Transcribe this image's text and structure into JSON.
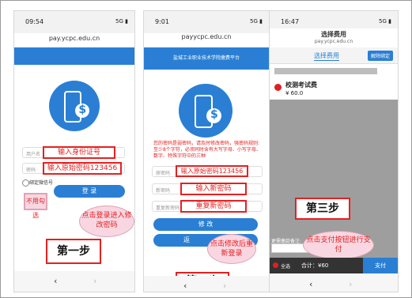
{
  "phone1": {
    "time": "09:54",
    "status_icons": "5G ▮",
    "url": "pay.ycpc.edu.cn",
    "user_placeholder": "用户名",
    "user_hint": "输入身份证号",
    "pass_placeholder": "密码",
    "pass_hint": "输入原始密码123456",
    "bind_wechat": "绑定微信号",
    "no_check_note": "不用勾选",
    "login_btn": "登 录",
    "login_tip": "点击登录进入修改密码",
    "step_label": "第一步",
    "nav_back": "‹",
    "nav_fwd": "›"
  },
  "phone2": {
    "time": "9:01",
    "status_icons": "5G ▮",
    "url": "payycpc.edu.cn",
    "banner": "盐城工业职业技术学院缴费平台",
    "notice": "您的密码是弱密码，请及时修改密码，强密码规则:至少8个字符，必须同时含有大写字母、小写字母、数字、特殊字符中的三种",
    "orig_label": "原密码",
    "orig_hint": "输入原始密码123456",
    "new_label": "新密码",
    "new_hint": "输入新密码",
    "repeat_label": "重复新密码",
    "repeat_hint": "重复新密码",
    "modify_btn": "修 改",
    "back_btn": "返",
    "modify_tip": "点击修改后重新登录",
    "step_label": "第二步",
    "nav_back": "‹",
    "nav_fwd": "›"
  },
  "phone3": {
    "time": "16:47",
    "status_icons": "5G ▮",
    "page_title": "选择费用",
    "url": "pay.ycpc.edu.cn",
    "tab_label": "选择费用",
    "unbind_btn": "解除绑定",
    "fee_name": "校测考试费",
    "fee_amount": "¥ 60.0",
    "step_label": "第三步",
    "remark_label": "更需缴款备注:",
    "pay_tip": "点击支付按钮进行支付",
    "select_all": "全选",
    "total": "合计：¥60",
    "pay_btn": "支付",
    "nav_back": "‹",
    "nav_fwd": "›"
  }
}
